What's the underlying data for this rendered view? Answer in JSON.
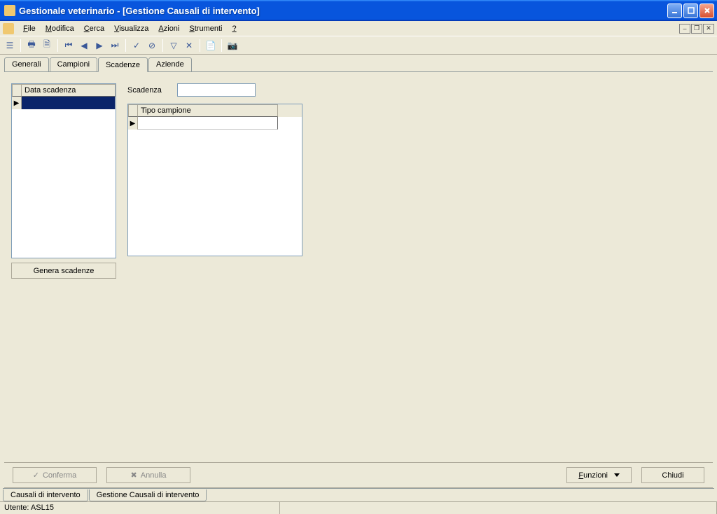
{
  "window": {
    "title": "Gestionale veterinario - [Gestione Causali di intervento]"
  },
  "menu": {
    "items": [
      "File",
      "Modifica",
      "Cerca",
      "Visualizza",
      "Azioni",
      "Strumenti",
      "?"
    ]
  },
  "tabs": {
    "items": [
      "Generali",
      "Campioni",
      "Scadenze",
      "Aziende"
    ],
    "active": "Scadenze"
  },
  "left_grid": {
    "header": "Data scadenza"
  },
  "button_genera": "Genera scadenze",
  "field_scadenza": {
    "label": "Scadenza",
    "value": ""
  },
  "right_grid": {
    "header": "Tipo campione"
  },
  "buttons": {
    "conferma": "Conferma",
    "annulla": "Annulla",
    "funzioni": "Funzioni",
    "chiudi": "Chiudi"
  },
  "sub_tabs": [
    "Causali di intervento",
    "Gestione Causali di intervento"
  ],
  "status": {
    "user": "Utente: ASL15"
  }
}
